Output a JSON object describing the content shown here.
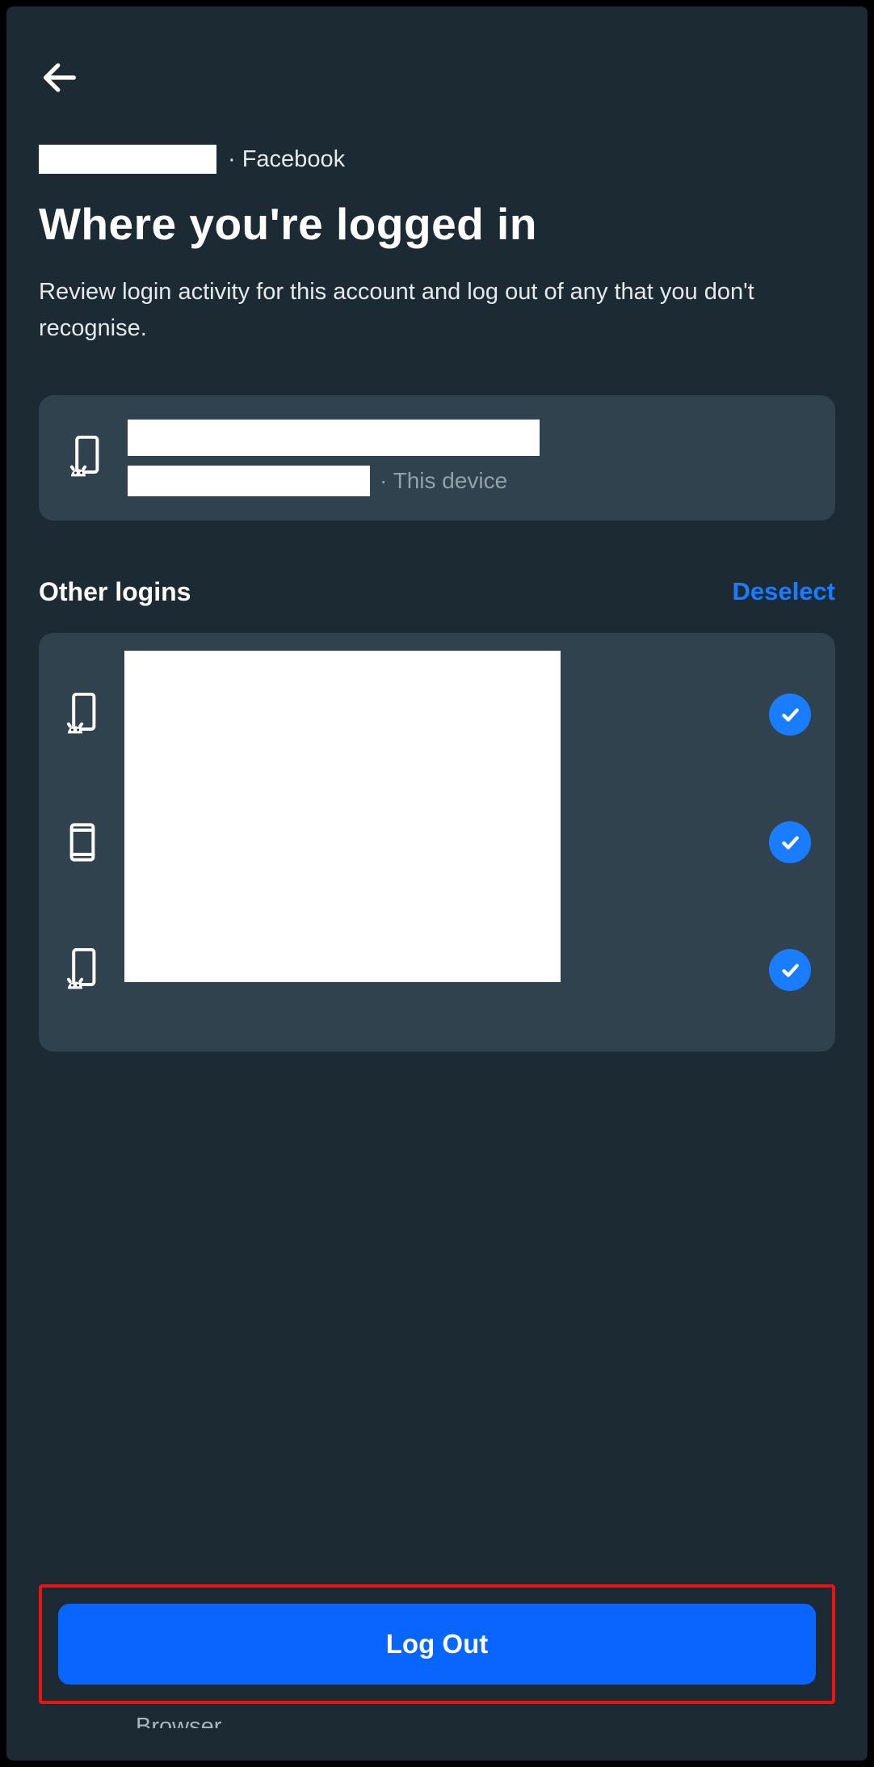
{
  "breadcrumb": {
    "suffix": "· Facebook"
  },
  "page": {
    "title": "Where you're logged in",
    "subtitle": "Review login activity for this account and log out of any that you don't recognise."
  },
  "current_device": {
    "suffix": "· This device"
  },
  "other_logins": {
    "heading": "Other logins",
    "action": "Deselect",
    "items": [
      {
        "icon": "android-phone",
        "selected": true
      },
      {
        "icon": "tablet",
        "selected": true
      },
      {
        "icon": "android-phone",
        "selected": true
      }
    ]
  },
  "footer": {
    "logout_label": "Log Out"
  },
  "cutoff_text": "Browser"
}
